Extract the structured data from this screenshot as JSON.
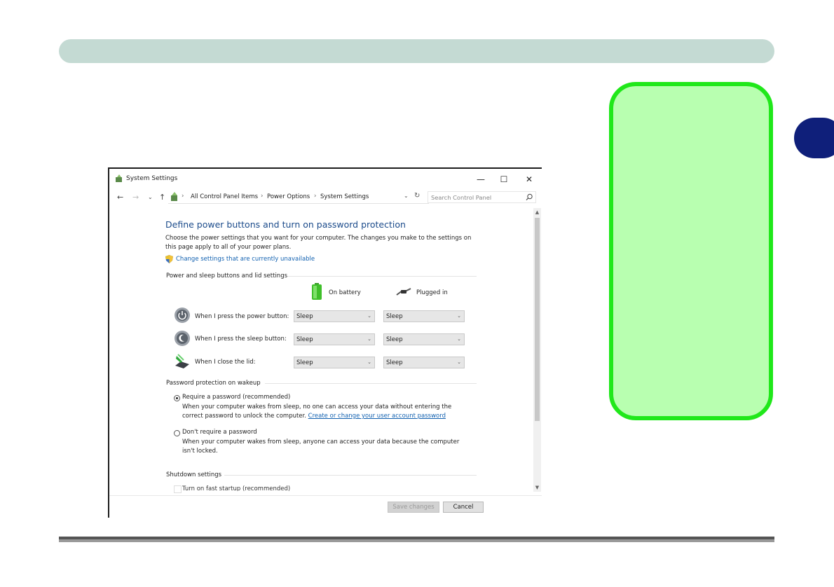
{
  "window": {
    "title": "System Settings",
    "controls": {
      "minimize": "—",
      "maximize": "☐",
      "close": "✕"
    }
  },
  "address_bar": {
    "breadcrumbs": [
      "All Control Panel Items",
      "Power Options",
      "System Settings"
    ],
    "search_placeholder": "Search Control Panel"
  },
  "content": {
    "heading": "Define power buttons and turn on password protection",
    "description": "Choose the power settings that you want for your computer. The changes you make to the settings on this page apply to all of your power plans.",
    "change_settings_link": "Change settings that are currently unavailable",
    "power_section": {
      "title": "Power and sleep buttons and lid settings",
      "columns": [
        "On battery",
        "Plugged in"
      ],
      "rows": [
        {
          "label": "When I press the power button:",
          "on_battery": "Sleep",
          "plugged_in": "Sleep",
          "icon": "power-button-icon"
        },
        {
          "label": "When I press the sleep button:",
          "on_battery": "Sleep",
          "plugged_in": "Sleep",
          "icon": "sleep-button-icon"
        },
        {
          "label": "When I close the lid:",
          "on_battery": "Sleep",
          "plugged_in": "Sleep",
          "icon": "laptop-lid-icon"
        }
      ]
    },
    "password_section": {
      "title": "Password protection on wakeup",
      "require_label": "Require a password (recommended)",
      "require_desc_prefix": "When your computer wakes from sleep, no one can access your data without entering the correct password to unlock the computer.",
      "require_link": "Create or change your user account password",
      "require_checked": true,
      "dont_require_label": "Don't require a password",
      "dont_require_desc": "When your computer wakes from sleep, anyone can access your data because the computer isn't locked."
    },
    "shutdown_section": {
      "title": "Shutdown settings",
      "fast_startup_label": "Turn on fast startup (recommended)"
    }
  },
  "footer": {
    "save_label": "Save changes",
    "cancel_label": "Cancel"
  },
  "colors": {
    "top_bar": "#c4dad3",
    "chapter_tab": "#0f1f7a",
    "note_fill": "#b8ffb0",
    "note_border": "#20e81a",
    "heading_blue": "#1a4a8a",
    "link_blue": "#1060b0"
  }
}
